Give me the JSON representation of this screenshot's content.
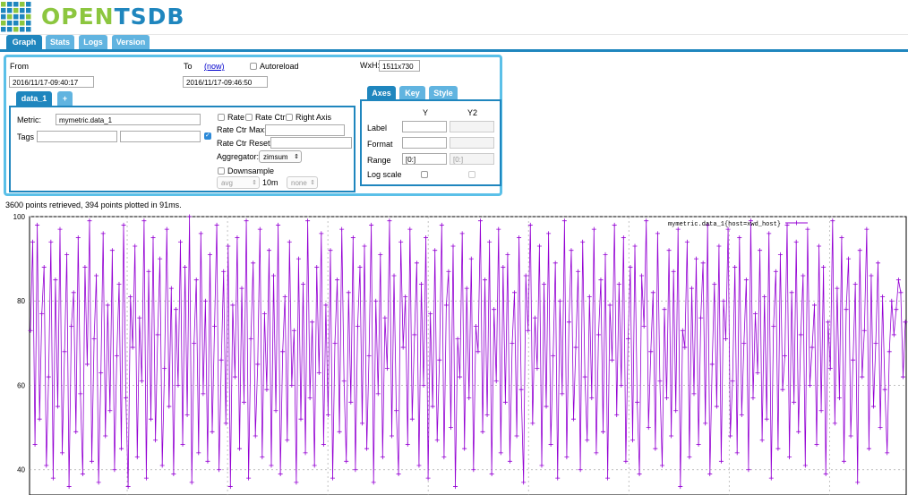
{
  "app": {
    "logo_text": "OPENTSDB"
  },
  "main_tabs": [
    {
      "label": "Graph",
      "active": true
    },
    {
      "label": "Stats",
      "active": false
    },
    {
      "label": "Logs",
      "active": false
    },
    {
      "label": "Version",
      "active": false
    }
  ],
  "time": {
    "from_label": "From",
    "from_value": "2016/11/17-09:40:17",
    "to_label": "To",
    "now_link": "(now)",
    "to_value": "2016/11/17-09:46:50",
    "autoreload_label": "Autoreload",
    "autoreload_checked": false,
    "wxh_label": "WxH:",
    "wxh_value": "1511x730"
  },
  "metric_tabs": [
    {
      "label": "data_1"
    },
    {
      "label": "+"
    }
  ],
  "query": {
    "metric_label": "Metric:",
    "metric_value": "mymetric.data_1",
    "tags_label": "Tags",
    "tag_key": "",
    "tag_value": "",
    "tag_group_checked": true,
    "rate_label": "Rate",
    "rate_ctr_label": "Rate Ctr",
    "right_axis_label": "Right Axis",
    "rate_ctr_max_label": "Rate Ctr Max:",
    "rate_ctr_reset_label": "Rate Ctr Reset:",
    "aggregator_label": "Aggregator:",
    "aggregator_value": "zimsum",
    "downsample_label": "Downsample",
    "downsample_func": "avg",
    "downsample_interval": "10m",
    "downsample_fill": "none"
  },
  "axes_tabs": [
    {
      "label": "Axes",
      "active": true
    },
    {
      "label": "Key",
      "active": false
    },
    {
      "label": "Style",
      "active": false
    }
  ],
  "axes": {
    "col_y": "Y",
    "col_y2": "Y2",
    "label_row": "Label",
    "format_row": "Format",
    "range_row": "Range",
    "range_y": "[0:]",
    "range_y2": "[0:]",
    "logscale_row": "Log scale"
  },
  "status_text": "3600 points retrieved, 394 points plotted in 91ms.",
  "colors": {
    "accent": "#1f86be",
    "tab_light": "#61b4e0",
    "panel_border": "#5bc0e8",
    "series": "#9400d3",
    "logo_green": "#8cc63f",
    "logo_blue": "#1f86be"
  },
  "chart_data": {
    "type": "line",
    "title": "",
    "xlabel": "",
    "ylabel": "",
    "ylim": [
      34,
      100
    ],
    "y_ticks": [
      40,
      60,
      80,
      100
    ],
    "grid": true,
    "legend_position": "top-right",
    "series": [
      {
        "name": "mymetric.data_1{host=xwd_host}",
        "values": [
          73,
          94,
          46,
          98,
          52,
          77,
          88,
          41,
          62,
          94,
          38,
          85,
          55,
          97,
          44,
          68,
          91,
          36,
          74,
          82,
          49,
          95,
          58,
          39,
          88,
          65,
          99,
          42,
          71,
          86,
          37,
          63,
          96,
          48,
          79,
          54,
          92,
          40,
          67,
          84,
          45,
          98,
          57,
          36,
          81,
          69,
          93,
          43,
          76,
          61,
          99,
          38,
          87,
          52,
          95,
          47,
          72,
          90,
          41,
          64,
          97,
          55,
          83,
          39,
          78,
          60,
          94,
          46,
          88,
          53,
          100,
          37,
          70,
          85,
          44,
          96,
          58,
          80,
          42,
          91,
          49,
          74,
          98,
          40,
          66,
          87,
          51,
          93,
          36,
          79,
          62,
          95,
          45,
          83,
          56,
          99,
          38,
          71,
          89,
          48,
          65,
          97,
          43,
          77,
          59,
          92,
          41,
          86,
          54,
          98,
          39,
          68,
          81,
          47,
          94,
          60,
          73,
          37,
          90,
          52,
          84,
          44,
          99,
          57,
          75,
          41,
          88,
          63,
          96,
          46,
          79,
          53,
          92,
          38,
          70,
          85,
          49,
          97,
          61,
          42,
          82,
          56,
          95,
          40,
          74,
          88,
          51,
          93,
          45,
          67,
          98,
          37,
          80,
          58,
          91,
          43,
          76,
          64,
          99,
          48,
          86,
          54,
          39,
          94,
          69,
          81,
          46,
          97,
          52,
          72,
          89,
          41,
          84,
          60,
          95,
          38,
          77,
          55,
          92,
          47,
          66,
          98,
          43,
          79,
          87,
          50,
          93,
          36,
          71,
          62,
          96,
          45,
          83,
          57,
          90,
          40,
          74,
          68,
          99,
          49,
          85,
          53,
          94,
          39,
          78,
          61,
          97,
          44,
          88,
          56,
          91,
          42,
          70,
          82,
          48,
          95,
          59,
          37,
          86,
          73,
          98,
          51,
          76,
          64,
          93,
          41,
          84,
          55,
          96,
          46,
          67,
          89,
          38,
          80,
          58,
          99,
          43,
          75,
          92,
          52,
          69,
          87,
          40,
          94,
          62,
          47,
          81,
          57,
          97,
          44,
          72,
          85,
          49,
          91,
          38,
          79,
          66,
          98,
          53,
          84,
          60,
          95,
          42,
          71,
          88,
          47,
          93,
          56,
          39,
          86,
          74,
          99,
          50,
          68,
          82,
          45,
          96,
          61,
          41,
          78,
          57,
          92,
          48,
          87,
          54,
          97,
          36,
          73,
          69,
          94,
          43,
          83,
          58,
          90,
          46,
          76,
          89,
          51,
          98,
          39,
          65,
          84,
          55,
          93,
          42,
          80,
          71,
          97,
          48,
          61,
          88,
          44,
          95,
          53,
          70,
          85,
          40,
          99,
          57,
          77,
          63,
          92,
          47,
          81,
          52,
          96,
          38,
          74,
          87,
          45,
          91,
          59,
          67,
          98,
          43,
          82,
          56,
          94,
          49,
          72,
          86,
          41,
          97,
          60,
          69,
          79,
          46,
          93,
          54,
          88,
          39,
          75,
          64,
          99,
          51,
          83,
          57,
          95,
          42,
          78,
          90,
          48,
          66,
          84,
          37,
          92,
          62,
          73,
          97,
          45,
          86,
          55,
          70,
          89,
          50,
          81,
          59,
          44,
          68,
          80,
          72,
          78,
          85,
          82,
          62,
          75
        ]
      }
    ]
  }
}
